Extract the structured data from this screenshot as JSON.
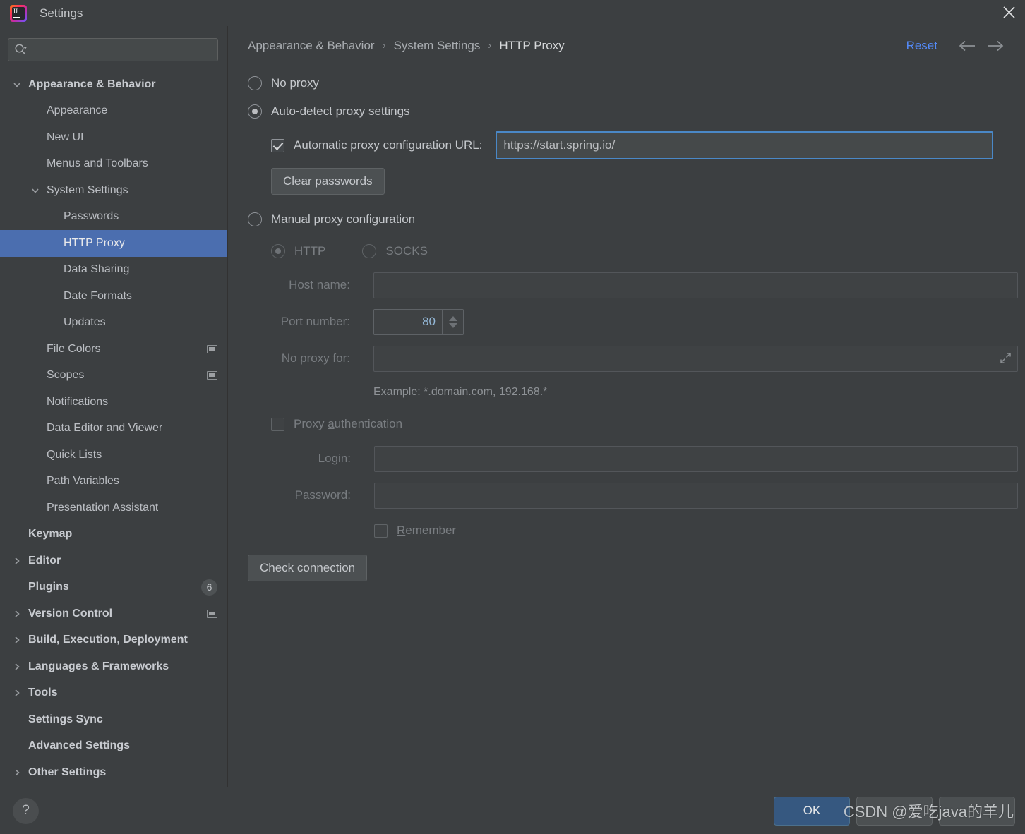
{
  "window": {
    "title": "Settings",
    "logo_icon": "intellij-idea-logo",
    "close_icon": "close-icon"
  },
  "sidebar": {
    "search": {
      "placeholder": "",
      "value": "",
      "icon": "search-icon",
      "dropdown_icon": "chevron-down-icon"
    },
    "items": [
      {
        "label": "Appearance & Behavior",
        "indent": 0,
        "bold": true,
        "arrow": "expanded"
      },
      {
        "label": "Appearance",
        "indent": 1,
        "bold": false,
        "arrow": "none"
      },
      {
        "label": "New UI",
        "indent": 1,
        "bold": false,
        "arrow": "none"
      },
      {
        "label": "Menus and Toolbars",
        "indent": 1,
        "bold": false,
        "arrow": "none"
      },
      {
        "label": "System Settings",
        "indent": 1,
        "bold": false,
        "arrow": "expanded"
      },
      {
        "label": "Passwords",
        "indent": 2,
        "bold": false,
        "arrow": "none"
      },
      {
        "label": "HTTP Proxy",
        "indent": 2,
        "bold": false,
        "arrow": "none",
        "selected": true
      },
      {
        "label": "Data Sharing",
        "indent": 2,
        "bold": false,
        "arrow": "none"
      },
      {
        "label": "Date Formats",
        "indent": 2,
        "bold": false,
        "arrow": "none"
      },
      {
        "label": "Updates",
        "indent": 2,
        "bold": false,
        "arrow": "none"
      },
      {
        "label": "File Colors",
        "indent": 1,
        "bold": false,
        "arrow": "none",
        "trailing_icon": "project-scope-icon"
      },
      {
        "label": "Scopes",
        "indent": 1,
        "bold": false,
        "arrow": "none",
        "trailing_icon": "project-scope-icon"
      },
      {
        "label": "Notifications",
        "indent": 1,
        "bold": false,
        "arrow": "none"
      },
      {
        "label": "Data Editor and Viewer",
        "indent": 1,
        "bold": false,
        "arrow": "none"
      },
      {
        "label": "Quick Lists",
        "indent": 1,
        "bold": false,
        "arrow": "none"
      },
      {
        "label": "Path Variables",
        "indent": 1,
        "bold": false,
        "arrow": "none"
      },
      {
        "label": "Presentation Assistant",
        "indent": 1,
        "bold": false,
        "arrow": "none"
      },
      {
        "label": "Keymap",
        "indent": 0,
        "bold": true,
        "arrow": "none"
      },
      {
        "label": "Editor",
        "indent": 0,
        "bold": true,
        "arrow": "collapsed"
      },
      {
        "label": "Plugins",
        "indent": 0,
        "bold": true,
        "arrow": "none",
        "badge": "6"
      },
      {
        "label": "Version Control",
        "indent": 0,
        "bold": true,
        "arrow": "collapsed",
        "trailing_icon": "project-scope-icon"
      },
      {
        "label": "Build, Execution, Deployment",
        "indent": 0,
        "bold": true,
        "arrow": "collapsed"
      },
      {
        "label": "Languages & Frameworks",
        "indent": 0,
        "bold": true,
        "arrow": "collapsed"
      },
      {
        "label": "Tools",
        "indent": 0,
        "bold": true,
        "arrow": "collapsed"
      },
      {
        "label": "Settings Sync",
        "indent": 0,
        "bold": true,
        "arrow": "none"
      },
      {
        "label": "Advanced Settings",
        "indent": 0,
        "bold": true,
        "arrow": "none"
      },
      {
        "label": "Other Settings",
        "indent": 0,
        "bold": true,
        "arrow": "collapsed"
      }
    ]
  },
  "breadcrumb": {
    "items": [
      "Appearance & Behavior",
      "System Settings",
      "HTTP Proxy"
    ],
    "separator": "›",
    "reset_label": "Reset",
    "back_icon": "arrow-left-icon",
    "forward_icon": "arrow-right-icon"
  },
  "proxy": {
    "no_proxy_label": "No proxy",
    "auto_detect_label": "Auto-detect proxy settings",
    "auto_config_url_label": "Automatic proxy configuration URL:",
    "auto_config_url_value": "https://start.spring.io/",
    "clear_passwords_label": "Clear passwords",
    "manual_label": "Manual proxy configuration",
    "http_label": "HTTP",
    "socks_label": "SOCKS",
    "host_name_label": "Host name:",
    "host_name_value": "",
    "port_number_label": "Port number:",
    "port_number_value": "80",
    "no_proxy_for_label": "No proxy for:",
    "no_proxy_for_value": "",
    "no_proxy_for_expand_icon": "expand-icon",
    "example_hint": "Example: *.domain.com, 192.168.*",
    "proxy_auth_label_pre": "Proxy ",
    "proxy_auth_label_mnemonic": "a",
    "proxy_auth_label_post": "uthentication",
    "login_label": "Login:",
    "login_value": "",
    "password_label": "Password:",
    "password_value": "",
    "remember_label_mnemonic": "R",
    "remember_label_post": "emember",
    "check_connection_label": "Check connection",
    "selected_mode": "auto-detect",
    "selected_manual_protocol": "HTTP"
  },
  "footer": {
    "help_icon": "help-icon",
    "help_label": "?",
    "ok_label": "OK",
    "button2_label": "",
    "button3_label": "",
    "watermark": "CSDN @爱吃java的羊儿"
  },
  "colors": {
    "accent_selection": "#4B6EAF",
    "accent_link": "#548AF7",
    "ok_button": "#365880",
    "focus_border": "#4A88C7",
    "window_bg": "#3C3F41"
  }
}
